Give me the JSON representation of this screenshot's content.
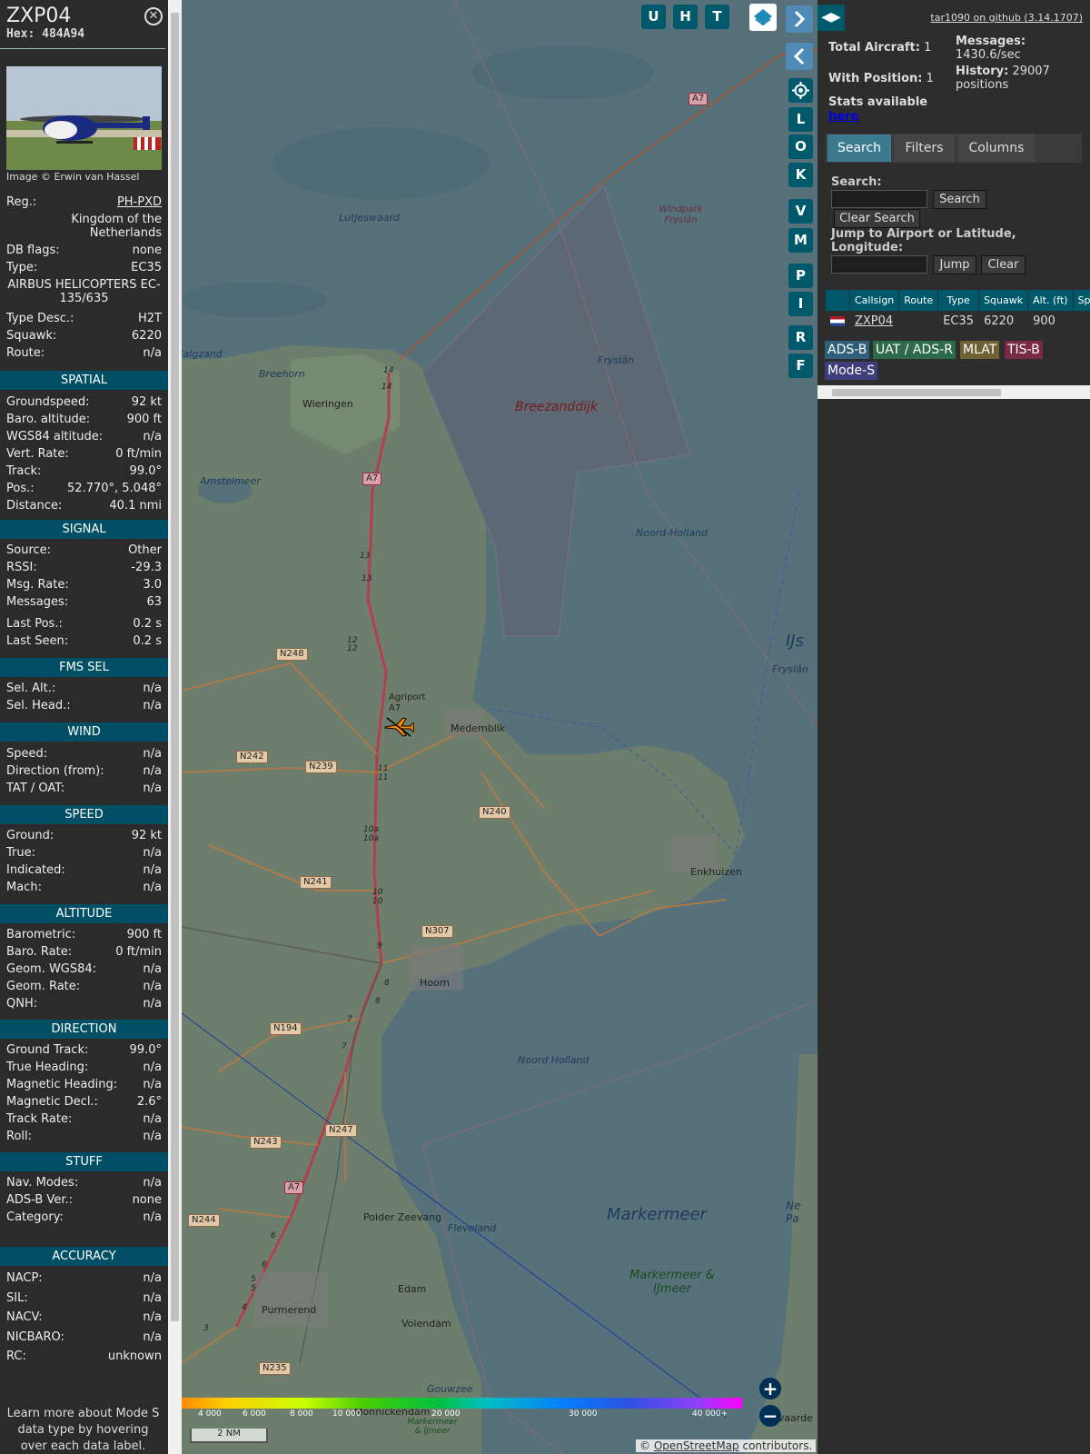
{
  "aircraft": {
    "callsign": "ZXP04",
    "hex_label": "Hex:",
    "hex": "484A94",
    "image_credit": "Image © Erwin van Hassel",
    "reg_label": "Reg.:",
    "reg": "PH-PXD",
    "country": "Kingdom of the Netherlands",
    "db_flags_label": "DB flags:",
    "db_flags": "none",
    "type_label": "Type:",
    "type": "EC35",
    "type_full": "AIRBUS HELICOPTERS EC-135/635",
    "type_desc_label": "Type Desc.:",
    "type_desc": "H2T",
    "squawk_label": "Squawk:",
    "squawk": "6220",
    "route_label": "Route:",
    "route": "n/a"
  },
  "sections": {
    "spatial": "SPATIAL",
    "signal": "SIGNAL",
    "fms": "FMS SEL",
    "wind": "WIND",
    "speed": "SPEED",
    "altitude": "ALTITUDE",
    "direction": "DIRECTION",
    "stuff": "STUFF",
    "accuracy": "ACCURACY"
  },
  "spatial": [
    {
      "k": "Groundspeed:",
      "v": "92 kt"
    },
    {
      "k": "Baro. altitude:",
      "v": "900 ft"
    },
    {
      "k": "WGS84 altitude:",
      "v": "n/a"
    },
    {
      "k": "Vert. Rate:",
      "v": "0 ft/min"
    },
    {
      "k": "Track:",
      "v": "99.0°"
    },
    {
      "k": "Pos.:",
      "v": "52.770°, 5.048°"
    },
    {
      "k": "Distance:",
      "v": "40.1 nmi"
    }
  ],
  "signal": [
    {
      "k": "Source:",
      "v": "Other"
    },
    {
      "k": "RSSI:",
      "v": "-29.3"
    },
    {
      "k": "Msg. Rate:",
      "v": "3.0"
    },
    {
      "k": "Messages:",
      "v": "63"
    },
    {
      "k": "Last Pos.:",
      "v": "0.2 s"
    },
    {
      "k": "Last Seen:",
      "v": "0.2 s"
    }
  ],
  "fms": [
    {
      "k": "Sel. Alt.:",
      "v": "n/a"
    },
    {
      "k": "Sel. Head.:",
      "v": "n/a"
    }
  ],
  "wind": [
    {
      "k": "Speed:",
      "v": "n/a"
    },
    {
      "k": "Direction (from):",
      "v": "n/a"
    },
    {
      "k": "TAT / OAT:",
      "v": "n/a"
    }
  ],
  "speed": [
    {
      "k": "Ground:",
      "v": "92 kt"
    },
    {
      "k": "True:",
      "v": "n/a"
    },
    {
      "k": "Indicated:",
      "v": "n/a"
    },
    {
      "k": "Mach:",
      "v": "n/a"
    }
  ],
  "altitude": [
    {
      "k": "Barometric:",
      "v": "900 ft"
    },
    {
      "k": "Baro. Rate:",
      "v": "0 ft/min"
    },
    {
      "k": "Geom. WGS84:",
      "v": "n/a"
    },
    {
      "k": "Geom. Rate:",
      "v": "n/a"
    },
    {
      "k": "QNH:",
      "v": "n/a"
    }
  ],
  "direction": [
    {
      "k": "Ground Track:",
      "v": "99.0°"
    },
    {
      "k": "True Heading:",
      "v": "n/a"
    },
    {
      "k": "Magnetic Heading:",
      "v": "n/a"
    },
    {
      "k": "Magnetic Decl.:",
      "v": "2.6°"
    },
    {
      "k": "Track Rate:",
      "v": "n/a"
    },
    {
      "k": "Roll:",
      "v": "n/a"
    }
  ],
  "stuff": [
    {
      "k": "Nav. Modes:",
      "v": "n/a"
    },
    {
      "k": "ADS-B Ver.:",
      "v": "none"
    },
    {
      "k": "Category:",
      "v": "n/a"
    }
  ],
  "accuracy": [
    {
      "k": "NACP:",
      "v": "n/a"
    },
    {
      "k": "SIL:",
      "v": "n/a"
    },
    {
      "k": "NACV:",
      "v": "n/a"
    },
    {
      "k": "NICBARO:",
      "v": "n/a"
    },
    {
      "k": "RC:",
      "v": "unknown"
    }
  ],
  "learn_more": "Learn more about Mode S data type by hovering over each data label.",
  "map": {
    "buttons_top": [
      "U",
      "H",
      "T"
    ],
    "buttons_side": [
      "L",
      "O",
      "K",
      "V",
      "M",
      "P",
      "I",
      "R",
      "F"
    ],
    "labels": {
      "wieringen": "Wieringen",
      "breezanddijk": "Breezanddijk",
      "windpark": "Windpark Fryslân",
      "lutjeswaard": "Lutjeswaard",
      "balgzand": "Balgzand",
      "breehorn": "Breehorn",
      "amstelmeer": "Amstelmeer",
      "agriport": "Agriport A7",
      "medemblik": "Medemblik",
      "enkhuizen": "Enkhuizen",
      "hoorn": "Hoorn",
      "markermeer": "Markermeer",
      "markermeer_ijmeer": "Markermeer & IJmeer",
      "markermeer_ijmeer_small": "Markermeer & IJmeer",
      "purmerend": "Purmerend",
      "edam": "Edam",
      "volendam": "Volendam",
      "polder": "Polder Zeevang",
      "noord_holland_1": "Noord-Holland",
      "noord_holland_2": "Noord Holland",
      "flevoland": "Flevoland",
      "fryslan_1": "Fryslân",
      "fryslan_2": "Fryslân",
      "ijs": "IJs",
      "gouwzee": "Gouwzee",
      "monnickendam": "Monnickendam",
      "ne_pa": "Ne Pa",
      "ostvaarde": "ostvaarde"
    },
    "shields": [
      "A7",
      "A7",
      "A7",
      "N248",
      "N242",
      "N239",
      "N240",
      "N241",
      "N307",
      "N194",
      "N243",
      "N247",
      "N244",
      "N235"
    ],
    "exits": [
      "14",
      "14",
      "13",
      "13",
      "12",
      "12",
      "11",
      "11",
      "10a",
      "10a",
      "10",
      "10",
      "9",
      "8",
      "8",
      "7",
      "7",
      "6",
      "6",
      "5",
      "5",
      "4",
      "3"
    ],
    "colorbar_ticks": [
      "4 000",
      "6 000",
      "8 000",
      "10 000",
      "20 000",
      "30 000",
      "40 000+"
    ],
    "scale": "2 NM",
    "attribution_prefix": "© ",
    "attribution_link": "OpenStreetMap",
    "attribution_suffix": " contributors."
  },
  "sidebar": {
    "github": "tar1090 on github (3.14.1707)",
    "total_aircraft_label": "Total Aircraft:",
    "total_aircraft": "1",
    "with_position_label": "With Position:",
    "with_position": "1",
    "messages_label": "Messages:",
    "messages_rate": "1430.6/sec",
    "history_label": "History:",
    "history": "29007",
    "history_unit": "positions",
    "stats_label": "Stats available",
    "stats_link": "here",
    "tabs": [
      "Search",
      "Filters",
      "Columns"
    ],
    "search_label": "Search:",
    "search_button": "Search",
    "clear_search_button": "Clear Search",
    "jump_label": "Jump to Airport or Latitude, Longitude:",
    "jump_button": "Jump",
    "clear_button": "Clear",
    "columns": [
      "Callsign",
      "Route",
      "Type",
      "Squawk",
      "Alt. (ft)",
      "Spd."
    ],
    "rows": [
      {
        "callsign": "ZXP04",
        "route": "",
        "type": "EC35",
        "squawk": "6220",
        "alt": "900",
        "spd": ""
      }
    ],
    "badges": [
      "ADS-B",
      "UAT / ADS-R",
      "MLAT",
      "TIS-B",
      "Mode-S"
    ]
  }
}
